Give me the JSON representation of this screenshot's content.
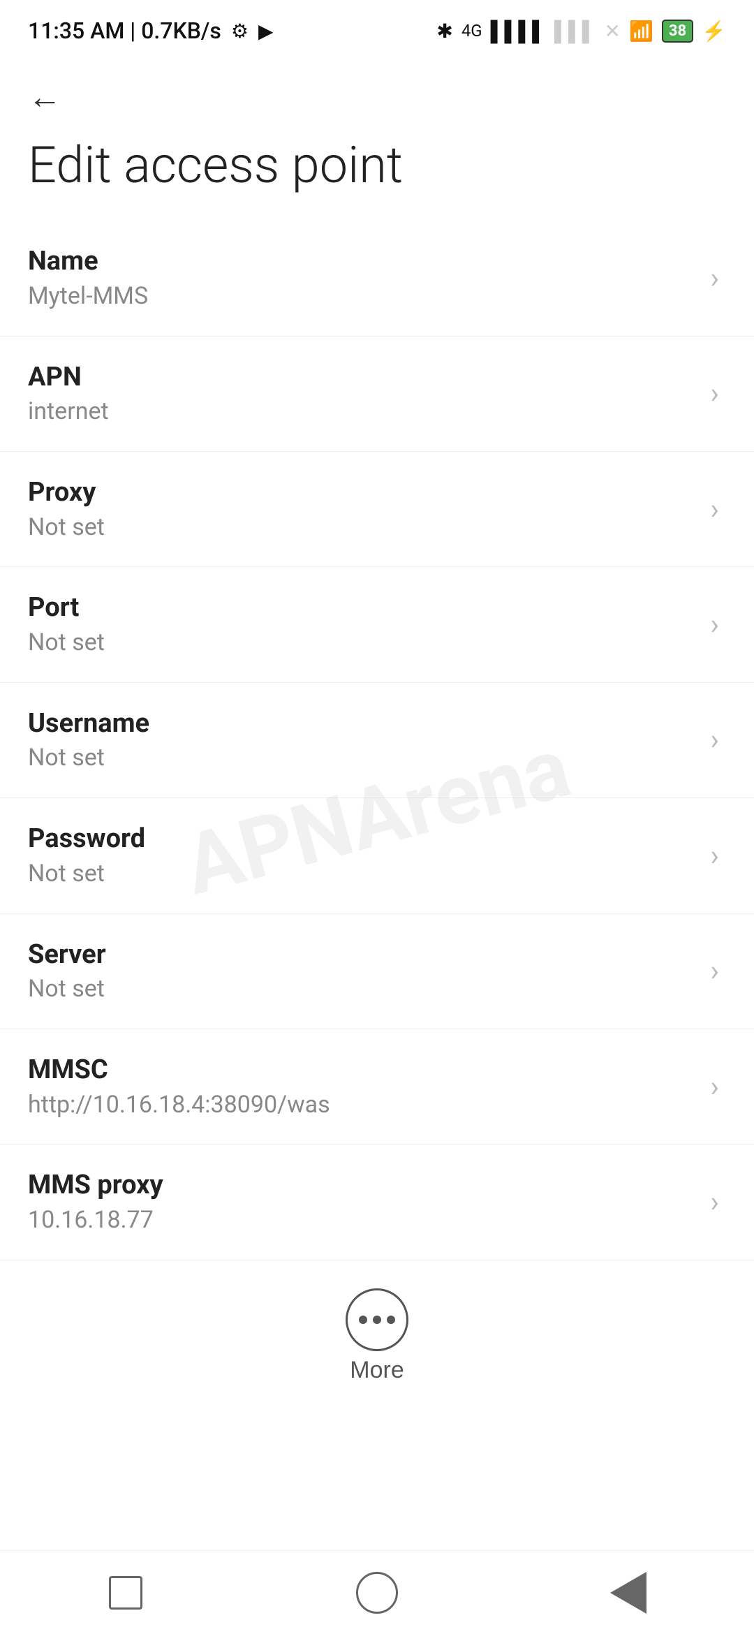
{
  "statusBar": {
    "time": "11:35 AM | 0.7KB/s",
    "batteryPercent": "38"
  },
  "page": {
    "title": "Edit access point"
  },
  "settings": [
    {
      "label": "Name",
      "value": "Mytel-MMS"
    },
    {
      "label": "APN",
      "value": "internet"
    },
    {
      "label": "Proxy",
      "value": "Not set"
    },
    {
      "label": "Port",
      "value": "Not set"
    },
    {
      "label": "Username",
      "value": "Not set"
    },
    {
      "label": "Password",
      "value": "Not set"
    },
    {
      "label": "Server",
      "value": "Not set"
    },
    {
      "label": "MMSC",
      "value": "http://10.16.18.4:38090/was"
    },
    {
      "label": "MMS proxy",
      "value": "10.16.18.77"
    }
  ],
  "more": {
    "label": "More"
  },
  "watermark": "APNArena"
}
